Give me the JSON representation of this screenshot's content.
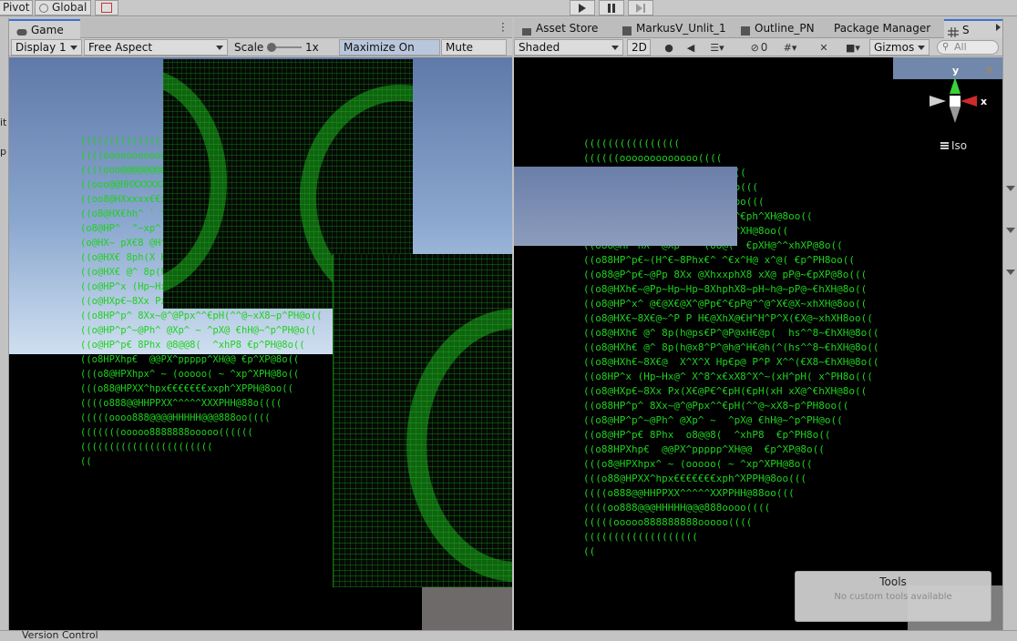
{
  "toolbar": {
    "pivot_label": "Pivot",
    "global_label": "Global"
  },
  "game": {
    "tab_label": "Game",
    "display_label": "Display 1",
    "aspect_label": "Free Aspect",
    "scale_label": "Scale",
    "scale_value": "1x",
    "maximize_label": "Maximize On Play",
    "mute_label": "Mute Audio",
    "ascii_cube": "(((((((((((((((((((((((\n((((oooooooooooooooooo((((\n((((ooo@@@@@@@@@@@@@@@@ooo((((\n((ooo@@HHXXXXXXXXXXXHH@@ooo((\n((oo8@HXxxxx€€xxxxxxXH@8oo((\n((o8@HX€hh^ ` ^^^ ^hhXH@8o((\n(o8@HP^  \"~xp^ ` ^px~\" ^PH@8o(\n(o@HX~ pX€8 @H^x^H@ 8€Xp ~XH@o(\n((o@HX€ 8ph(X H  H X)hp8 €XH@o((\n((o@HX€ @^ 8p(h@ps€P^@P@xH€@p( ^€XH@o((\n((o@HP^x (Hp~Hx@^ X^8^x€xX8^X^PH@o((\n((o@HXp€~8Xx Px(X€@P€^€pH(€pH xX@~€XH@o((\n((o8HP^p^ 8Xx~@^@Ppx^^€pH(^^@~xX8~p^PH@o((\n((o@HP^p^~@Ph^ @Xp^ ~ ^pX@ €hH@~^p^PH@o((\n((o@HP^p€ 8Phx @8@@8(  ^xhP8 €p^PH@8o((\n((o8HPXhp€  @@PX^ppppp^XH@@ €p^XP@8o((\n(((o8@HPXhpx^ ~ (ooooo( ~ ^xp^XPH@8o((\n(((o88@HPXX^hpx€€€€€€€xxph^XPPH@8oo((\n((((o888@@HHPPXX^^^^^XXXPHH@88o((((\n(((((oooo888@@@@HHHHH@@@888oo((((\n(((((((ooooo8888888ooooo((((((\n(((((((((((((((((((((((\n(("
  },
  "scene": {
    "tabs": [
      {
        "label": "Asset Store"
      },
      {
        "label": "MarkusV_Unlit_1"
      },
      {
        "label": "Outline_PN"
      },
      {
        "label": "Package Manager"
      },
      {
        "label": "S"
      }
    ],
    "shading_label": "Shaded",
    "mode_2d": "2D",
    "fx_count": "0",
    "gizmos_label": "Gizmos",
    "search_placeholder": "All",
    "axis_x": "x",
    "axis_y": "y",
    "projection_label": "Iso",
    "ascii_sphere": "((((((((((((((((\n((((((ooooooooooooo((((\n((((oo@@@@@@@@@@@@88ooo((((\n((ooo@@@HHXXXXXXXPPHH@@8oo(((\n((oo8@HXXxxxx€xxpph^XPH@8oo(((\n((o8@HXX€^hhh^  (((((  ~ ^€ph^XH@8oo((\n((o8@HPX^  ^hhh^XP@8(\"^xp^XH@8oo((\n((o88@HP^hX  @Xp    (oo@(  €pXH@^^xhXP@8o((\n((o88HP^p€~(H^€~8Phx€^ ^€x^H@ x^@( €p^PH8oo((\n((o88@P^p€~@Pp 8Xx @XhxxphX8 xX@ pP@~€pXP@8o(((\n((o8@HXh€~@Pp~Hp~Hp~8XhphX8~pH~h@~pP@~€hXH@8o((\n((o8@HP^x^ @€@X€@X^@Pp€^€pP@^^@^X€@X~xhXH@8oo((\n((o8@HX€~8X€@~^P P H€@XhX@€H^H^P^X(€X@~xhXH8oo((\n((o8@HXh€ @^ 8p(h@ps€P^@P@xH€@p(  hs^^8~€hXH@8o((\n((o8@HXh€ @^ 8p(h@x8^P^@h@^H€@h(^(hs^^8~€hXH@8o((\n((o8@HXh€~8X€@  X^X^X Hp€p@ P^P X^^(€X8~€hXH@8o((\n((o8HP^x (Hp~Hx@^ X^8^x€xX8^X^~(xH^pH( x^PH8o(((\n((o8@HXp€~8Xx Px(X€@P€^€pH(€pH(xH xX@^€hXH@8o((\n((o88HP^p^ 8Xx~@^@Ppx^^€pH(^^@~xX8~p^PH8oo((\n((o8@HP^p^~@Ph^ @Xp^ ~  ^pX@ €hH@~^p^PH@o((\n((o8@HP^p€ 8Phx  o8@@8(  ^xhP8  €p^PH8o((\n((o88HPXhp€  @@PX^ppppp^XH@@  €p^XP@8o((\n(((o8@HPXhpx^ ~ (ooooo( ~ ^xp^XPH@8o((\n(((o88@HPXX^hpx€€€€€€€xph^XPPH@8oo(((\n((((o888@@HHPPXX^^^^^XXPPHH@88oo(((\n((((oo888@@@HHHHH@@@888oooo((((\n(((((ooooo888888888ooooo((((\n(((((((((((((((((((\n(("
  },
  "tools": {
    "title": "Tools",
    "subtitle": "No custom tools available"
  },
  "footer": {
    "version_control_label": "Version Control"
  }
}
